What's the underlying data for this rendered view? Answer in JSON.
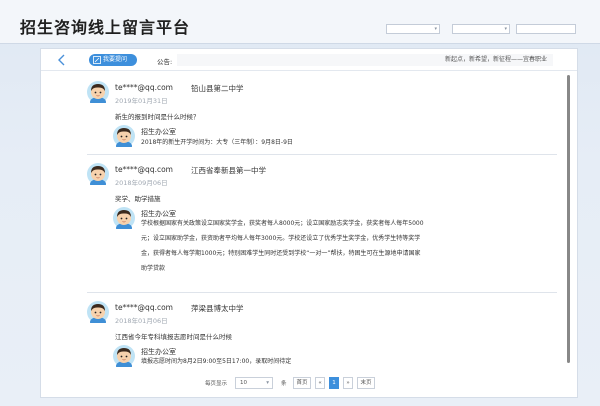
{
  "header": {
    "title": "招生咨询线上留言平台",
    "select1": "",
    "select2": ""
  },
  "toolbar": {
    "ask_button": "我要提问",
    "notice_label": "公告:",
    "notice_text": "新起点，新希望，新征程——宜春职业"
  },
  "messages": [
    {
      "user": "te****@qq.com",
      "school": "铅山县第二中学",
      "date": "2019年01月31日",
      "question": "新生的报到时间是什么时候？",
      "responder": "招生办公室",
      "answer": "2018年的新生开学时间为：大专（三年制）：9月8日-9日"
    },
    {
      "user": "te****@qq.com",
      "school": "江西省奉新县第一中学",
      "date": "2018年09月06日",
      "question": "奖学、助学措施",
      "responder": "招生办公室",
      "answer_lines": [
        "学校根据国家有关政策设立国家奖学金，获奖者每人8000元；设立国家励志奖学金，获奖者每人每年5000",
        "元；设立国家助学金，获资助者平均每人每年3000元。学校还设立了优秀学生奖学金，优秀学生特等奖学",
        "金，获得者每人每学期1000元；特别困难学生同时还受到学校“一对一”帮扶，特困生可在生源地申请国家",
        "助学贷款"
      ]
    },
    {
      "user": "te****@qq.com",
      "school": "萍梁县博太中学",
      "date": "2018年01月06日",
      "question": "江西省今年专科填报志愿时间是什么时候",
      "responder": "招生办公室",
      "answer": "填报志愿时间为8月2日9:00至5日17:00，录取时间待定"
    }
  ],
  "pagination": {
    "per_page_label": "每页显示",
    "per_page_value": "10",
    "unit": "条",
    "first": "首页",
    "prev": "«",
    "current": "1",
    "next": "»",
    "last": "末页"
  },
  "colors": {
    "accent": "#3d8fdc",
    "date": "#a0a8b2"
  }
}
